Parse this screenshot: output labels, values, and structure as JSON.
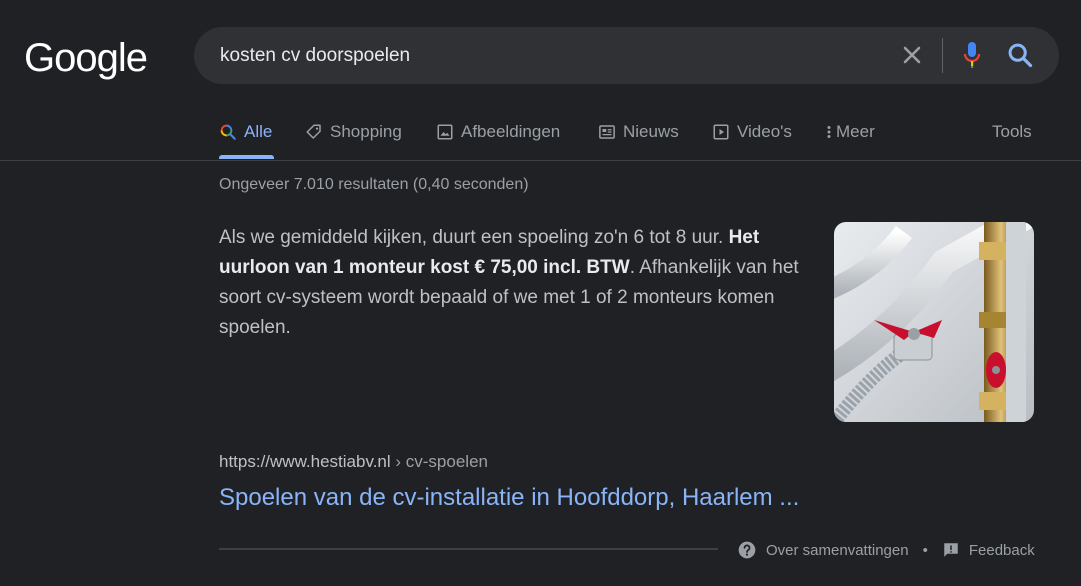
{
  "logo": {
    "text": "Google"
  },
  "search": {
    "query": "kosten cv doorspoelen"
  },
  "tabs": [
    {
      "label": "Alle",
      "icon": "search-icon"
    },
    {
      "label": "Shopping",
      "icon": "tag-icon"
    },
    {
      "label": "Afbeeldingen",
      "icon": "image-icon"
    },
    {
      "label": "Nieuws",
      "icon": "news-icon"
    },
    {
      "label": "Video's",
      "icon": "play-icon"
    },
    {
      "label": "Meer",
      "icon": "more-vert-icon"
    }
  ],
  "tools_label": "Tools",
  "stats": "Ongeveer 7.010 resultaten (0,40 seconden)",
  "snippet": {
    "part1": "Als we gemiddeld kijken, duurt een spoeling zo'n 6 tot 8 uur. ",
    "bold": "Het uurloon van 1 monteur kost € 75,00 incl. BTW",
    "part2": ". Afhankelijk van het soort cv-systeem wordt bepaald of we met 1 of 2 monteurs komen spoelen."
  },
  "result": {
    "domain": "https://www.hestiabv.nl",
    "path": " › cv-spoelen",
    "title": "Spoelen van de cv-installatie in Hoofddorp, Haarlem ..."
  },
  "footer": {
    "about": "Over samenvattingen",
    "separator": "•",
    "feedback": "Feedback"
  },
  "colors": {
    "accent": "#8ab4f8",
    "background": "#202124",
    "searchbox": "#303134"
  }
}
